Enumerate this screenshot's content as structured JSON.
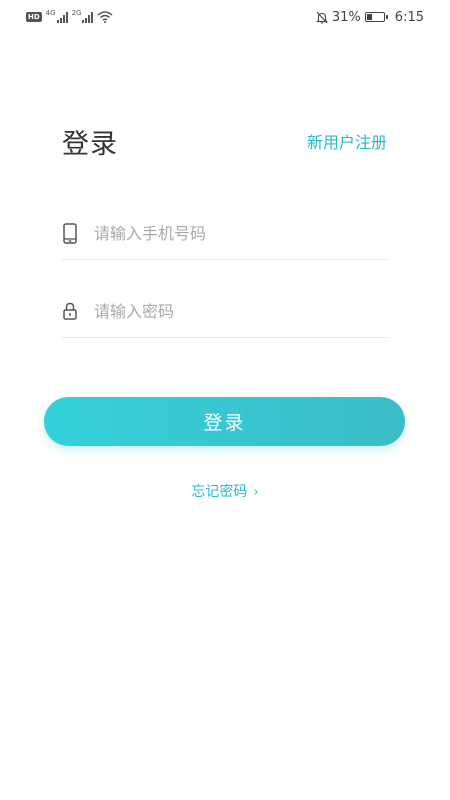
{
  "status_bar": {
    "hd_label": "HD",
    "net1": "4G",
    "net2": "2G",
    "battery_text": "31%",
    "battery_level": 0.31,
    "time": "6:15"
  },
  "header": {
    "title": "登录",
    "register_label": "新用户注册"
  },
  "form": {
    "phone_placeholder": "请输入手机号码",
    "password_placeholder": "请输入密码",
    "phone_value": "",
    "password_value": ""
  },
  "login_button_label": "登录",
  "forgot_label": "忘记密码",
  "forgot_chevron": "›",
  "colors": {
    "accent": "#2cb9c8",
    "button_start": "#34d1da",
    "button_end": "#3bbcc6"
  },
  "icons": {
    "phone": "phone-icon",
    "lock": "lock-icon",
    "wifi": "wifi-icon",
    "mute": "bell-off-icon",
    "battery": "battery-icon"
  }
}
